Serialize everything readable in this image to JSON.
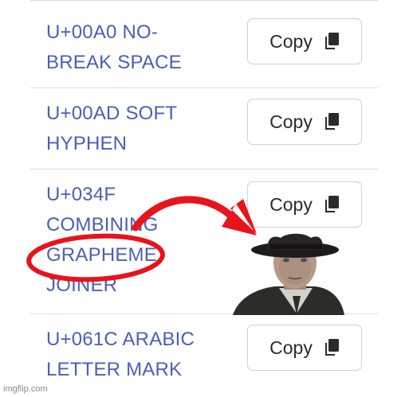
{
  "rows": [
    {
      "name_lines": [
        "U+00A0 NO-",
        "BREAK SPACE"
      ],
      "copy_label": "Copy"
    },
    {
      "name_lines": [
        "U+00AD SOFT",
        "HYPHEN"
      ],
      "copy_label": "Copy"
    },
    {
      "name_lines": [
        "U+034F",
        "COMBINING",
        "GRAPHEME",
        "JOINER"
      ],
      "copy_label": "Copy"
    },
    {
      "name_lines": [
        "U+061C ARABIC",
        "LETTER MARK"
      ],
      "copy_label": "Copy"
    }
  ],
  "icons": {
    "copy": "copy-icon",
    "arrow": "red-curved-arrow",
    "circle": "red-highlight-circle"
  },
  "colors": {
    "link_text": "#4a5fb5",
    "highlight": "#e8131b",
    "divider": "#dcdcdc"
  },
  "watermark": "imgflip.com"
}
